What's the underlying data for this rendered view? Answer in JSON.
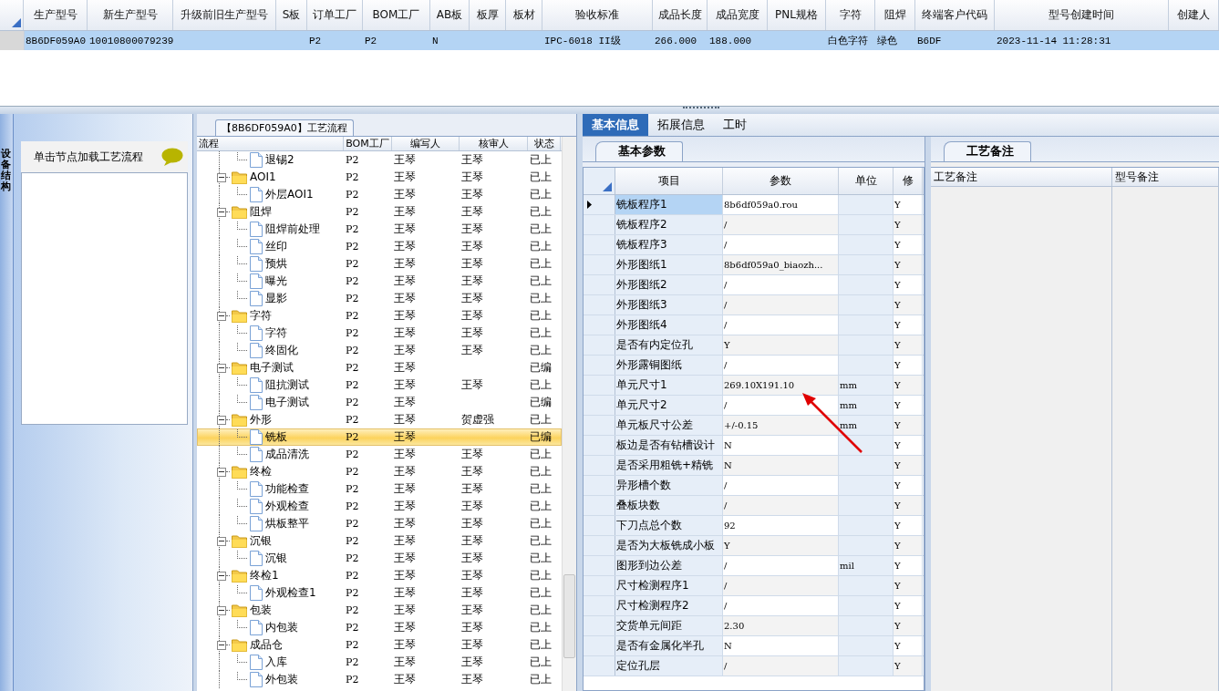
{
  "top_grid": {
    "columns": [
      "生产型号",
      "新生产型号",
      "升级前旧生产型号",
      "S板",
      "订单工厂",
      "BOM工厂",
      "AB板",
      "板厚",
      "板材",
      "验收标准",
      "成品长度",
      "成品宽度",
      "PNL规格",
      "字符",
      "阻焊",
      "终端客户代码",
      "型号创建时间",
      "创建人"
    ],
    "rows": [
      {
        "selected": true,
        "cells": [
          "8B6DF059A0",
          "10010800079239",
          "",
          "",
          "P2",
          "P2",
          "N",
          "",
          "",
          "IPC-6018 II级",
          "266.000",
          "188.000",
          "",
          "白色字符",
          "绿色",
          "B6DF",
          "2023-11-14 11:28:31",
          ""
        ]
      }
    ]
  },
  "side_tab": {
    "label": "设备结构"
  },
  "hint_panel": {
    "text": "单击节点加载工艺流程"
  },
  "flow_panel": {
    "title": "【8B6DF059A0】工艺流程",
    "columns": [
      "流程",
      "BOM工厂",
      "编写人",
      "核审人",
      "状态"
    ],
    "tree": [
      {
        "children": [
          {
            "name": "退锡2",
            "cells": [
              "P2",
              "王琴",
              "王琴",
              "已上"
            ],
            "selected": false
          }
        ]
      },
      {
        "name": "AOI1",
        "cells": [
          "P2",
          "王琴",
          "王琴",
          "已上"
        ],
        "selected": false,
        "expanded": true,
        "children": [
          {
            "name": "外层AOI1",
            "cells": [
              "P2",
              "王琴",
              "王琴",
              "已上"
            ],
            "selected": false
          }
        ]
      },
      {
        "name": "阻焊",
        "cells": [
          "P2",
          "王琴",
          "王琴",
          "已上"
        ],
        "selected": false,
        "expanded": true,
        "children": [
          {
            "name": "阻焊前处理",
            "cells": [
              "P2",
              "王琴",
              "王琴",
              "已上"
            ],
            "selected": false
          },
          {
            "name": "丝印",
            "cells": [
              "P2",
              "王琴",
              "王琴",
              "已上"
            ],
            "selected": false
          },
          {
            "name": "预烘",
            "cells": [
              "P2",
              "王琴",
              "王琴",
              "已上"
            ],
            "selected": false
          },
          {
            "name": "曝光",
            "cells": [
              "P2",
              "王琴",
              "王琴",
              "已上"
            ],
            "selected": false
          },
          {
            "name": "显影",
            "cells": [
              "P2",
              "王琴",
              "王琴",
              "已上"
            ],
            "selected": false
          }
        ]
      },
      {
        "name": "字符",
        "cells": [
          "P2",
          "王琴",
          "王琴",
          "已上"
        ],
        "selected": false,
        "expanded": true,
        "children": [
          {
            "name": "字符",
            "cells": [
              "P2",
              "王琴",
              "王琴",
              "已上"
            ],
            "selected": false
          },
          {
            "name": "终固化",
            "cells": [
              "P2",
              "王琴",
              "王琴",
              "已上"
            ],
            "selected": false
          }
        ]
      },
      {
        "name": "电子测试",
        "cells": [
          "P2",
          "王琴",
          "",
          "已编"
        ],
        "selected": false,
        "expanded": true,
        "children": [
          {
            "name": "阻抗测试",
            "cells": [
              "P2",
              "王琴",
              "王琴",
              "已上"
            ],
            "selected": false
          },
          {
            "name": "电子测试",
            "cells": [
              "P2",
              "王琴",
              "",
              "已编"
            ],
            "selected": false
          }
        ]
      },
      {
        "name": "外形",
        "cells": [
          "P2",
          "王琴",
          "贺虚强",
          "已上"
        ],
        "selected": false,
        "expanded": true,
        "children": [
          {
            "name": "铣板",
            "cells": [
              "P2",
              "王琴",
              "",
              "已编"
            ],
            "selected": true
          },
          {
            "name": "成品清洗",
            "cells": [
              "P2",
              "王琴",
              "王琴",
              "已上"
            ],
            "selected": false
          }
        ]
      },
      {
        "name": "终检",
        "cells": [
          "P2",
          "王琴",
          "王琴",
          "已上"
        ],
        "selected": false,
        "expanded": true,
        "children": [
          {
            "name": "功能检查",
            "cells": [
              "P2",
              "王琴",
              "王琴",
              "已上"
            ],
            "selected": false
          },
          {
            "name": "外观检查",
            "cells": [
              "P2",
              "王琴",
              "王琴",
              "已上"
            ],
            "selected": false
          },
          {
            "name": "烘板整平",
            "cells": [
              "P2",
              "王琴",
              "王琴",
              "已上"
            ],
            "selected": false
          }
        ]
      },
      {
        "name": "沉银",
        "cells": [
          "P2",
          "王琴",
          "王琴",
          "已上"
        ],
        "selected": false,
        "expanded": true,
        "children": [
          {
            "name": "沉银",
            "cells": [
              "P2",
              "王琴",
              "王琴",
              "已上"
            ],
            "selected": false
          }
        ]
      },
      {
        "name": "终检1",
        "cells": [
          "P2",
          "王琴",
          "王琴",
          "已上"
        ],
        "selected": false,
        "expanded": true,
        "children": [
          {
            "name": "外观检查1",
            "cells": [
              "P2",
              "王琴",
              "王琴",
              "已上"
            ],
            "selected": false
          }
        ]
      },
      {
        "name": "包装",
        "cells": [
          "P2",
          "王琴",
          "王琴",
          "已上"
        ],
        "selected": false,
        "expanded": true,
        "children": [
          {
            "name": "内包装",
            "cells": [
              "P2",
              "王琴",
              "王琴",
              "已上"
            ],
            "selected": false
          }
        ]
      },
      {
        "name": "成品仓",
        "cells": [
          "P2",
          "王琴",
          "王琴",
          "已上"
        ],
        "selected": false,
        "expanded": true,
        "children": [
          {
            "name": "入库",
            "cells": [
              "P2",
              "王琴",
              "王琴",
              "已上"
            ],
            "selected": false
          },
          {
            "name": "外包装",
            "cells": [
              "P2",
              "王琴",
              "王琴",
              "已上"
            ],
            "selected": false
          }
        ]
      }
    ]
  },
  "tabs": [
    {
      "label": "基本信息",
      "selected": true
    },
    {
      "label": "拓展信息",
      "selected": false
    },
    {
      "label": "工时",
      "selected": false
    }
  ],
  "params_panel": {
    "tab": "基本参数",
    "columns": [
      "项目",
      "参数",
      "单位",
      "修"
    ],
    "rows": [
      {
        "selected": true,
        "cells": [
          "铣板程序1",
          "8b6df059a0.rou",
          "",
          "Y"
        ]
      },
      {
        "selected": false,
        "cells": [
          "铣板程序2",
          "/",
          "",
          "Y"
        ]
      },
      {
        "selected": false,
        "cells": [
          "铣板程序3",
          "/",
          "",
          "Y"
        ]
      },
      {
        "selected": false,
        "cells": [
          "外形图纸1",
          "8b6df059a0_biaozh...",
          "",
          "Y"
        ]
      },
      {
        "selected": false,
        "cells": [
          "外形图纸2",
          "/",
          "",
          "Y"
        ]
      },
      {
        "selected": false,
        "cells": [
          "外形图纸3",
          "/",
          "",
          "Y"
        ]
      },
      {
        "selected": false,
        "cells": [
          "外形图纸4",
          "/",
          "",
          "Y"
        ]
      },
      {
        "selected": false,
        "cells": [
          "是否有内定位孔",
          "Y",
          "",
          "Y"
        ]
      },
      {
        "selected": false,
        "cells": [
          "外形露铜图纸",
          "/",
          "",
          "Y"
        ]
      },
      {
        "selected": false,
        "cells": [
          "单元尺寸1",
          "269.10X191.10",
          "mm",
          "Y"
        ]
      },
      {
        "selected": false,
        "cells": [
          "单元尺寸2",
          "/",
          "mm",
          "Y"
        ]
      },
      {
        "selected": false,
        "cells": [
          "单元板尺寸公差",
          "+/-0.15",
          "mm",
          "Y"
        ]
      },
      {
        "selected": false,
        "cells": [
          "板边是否有钻槽设计",
          "N",
          "",
          "Y"
        ]
      },
      {
        "selected": false,
        "cells": [
          "是否采用粗铣+精铣",
          "N",
          "",
          "Y"
        ]
      },
      {
        "selected": false,
        "cells": [
          "异形槽个数",
          "/",
          "",
          "Y"
        ]
      },
      {
        "selected": false,
        "cells": [
          "叠板块数",
          "/",
          "",
          "Y"
        ]
      },
      {
        "selected": false,
        "cells": [
          "下刀点总个数",
          "92",
          "",
          "Y"
        ]
      },
      {
        "selected": false,
        "cells": [
          "是否为大板铣成小板",
          "Y",
          "",
          "Y"
        ]
      },
      {
        "selected": false,
        "cells": [
          "图形到边公差",
          "/",
          "mil",
          "Y"
        ]
      },
      {
        "selected": false,
        "cells": [
          "尺寸检测程序1",
          "/",
          "",
          "Y"
        ]
      },
      {
        "selected": false,
        "cells": [
          "尺寸检测程序2",
          "/",
          "",
          "Y"
        ]
      },
      {
        "selected": false,
        "cells": [
          "交货单元间距",
          "2.30",
          "",
          "Y"
        ]
      },
      {
        "selected": false,
        "cells": [
          "是否有金属化半孔",
          "N",
          "",
          "Y"
        ]
      },
      {
        "selected": false,
        "cells": [
          "定位孔层",
          "/",
          "",
          "Y"
        ]
      }
    ]
  },
  "notes_panel": {
    "tab": "工艺备注",
    "columns": [
      "工艺备注",
      "型号备注"
    ]
  }
}
